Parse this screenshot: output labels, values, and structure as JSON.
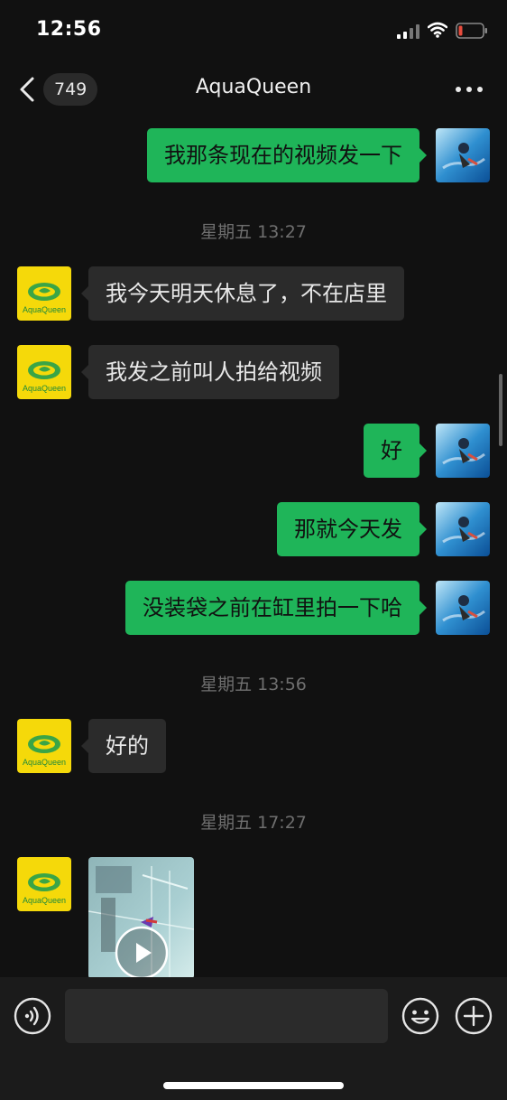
{
  "status": {
    "time": "12:56"
  },
  "header": {
    "unread_count": "749",
    "title": "AquaQueen"
  },
  "colors": {
    "outgoing_bubble": "#1fb559",
    "incoming_bubble": "#2b2b2b",
    "background": "#111111",
    "battery_low": "#e84c3d"
  },
  "icons": {
    "back": "chevron-left-icon",
    "more": "more-dots-icon",
    "voice": "voice-icon",
    "emoji": "emoji-icon",
    "plus": "plus-icon",
    "play": "play-icon"
  },
  "contact_avatar_text": "AquaQueen",
  "messages": [
    {
      "type": "out",
      "text": "我那条现在的视频发一下"
    },
    {
      "type": "time",
      "text": "星期五 13:27"
    },
    {
      "type": "in",
      "text": "我今天明天休息了，不在店里"
    },
    {
      "type": "in",
      "text": "我发之前叫人拍给视频"
    },
    {
      "type": "out",
      "text": "好"
    },
    {
      "type": "out",
      "text": "那就今天发"
    },
    {
      "type": "out",
      "text": "没装袋之前在缸里拍一下哈"
    },
    {
      "type": "time",
      "text": "星期五 13:56"
    },
    {
      "type": "in",
      "text": "好的"
    },
    {
      "type": "time",
      "text": "星期五 17:27"
    },
    {
      "type": "in_video",
      "text": ""
    }
  ]
}
